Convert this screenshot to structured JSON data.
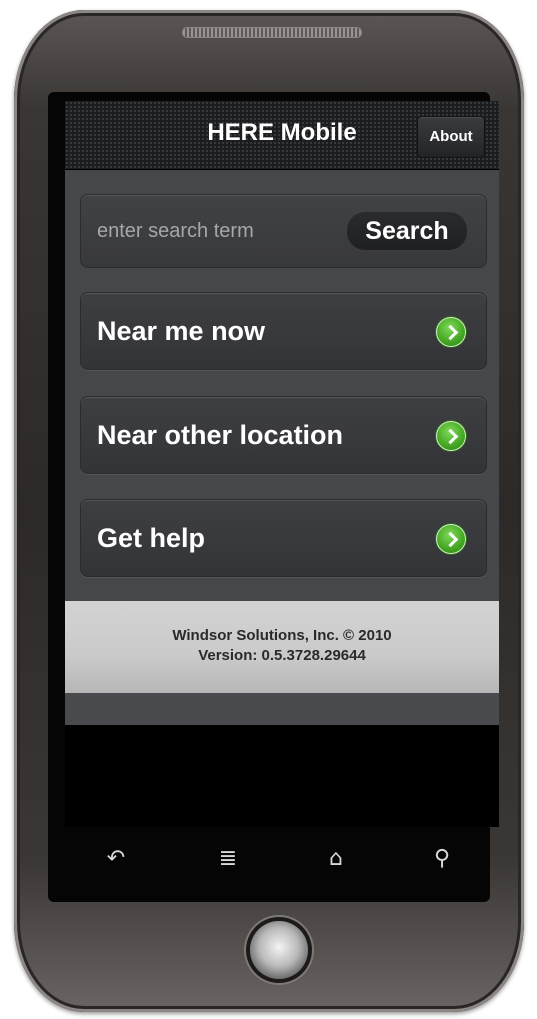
{
  "header": {
    "title": "HERE Mobile",
    "about_label": "About"
  },
  "search": {
    "placeholder": "enter search term",
    "button_label": "Search"
  },
  "menu": {
    "items": [
      {
        "label": "Near me now",
        "icon": "chevron-right-circle-icon"
      },
      {
        "label": "Near other location",
        "icon": "chevron-right-circle-icon"
      },
      {
        "label": "Get help",
        "icon": "chevron-right-circle-icon"
      }
    ]
  },
  "footer": {
    "copyright": "Windsor Solutions, Inc. © 2010",
    "version": "Version: 0.5.3728.29644"
  },
  "softkeys": {
    "back": "↶",
    "menu": "≣",
    "home": "⌂",
    "search": "⚲"
  },
  "colors": {
    "accent_green": "#3b9e1a",
    "titlebar_bg": "#1c1d1f",
    "content_bg": "#46474b",
    "footer_bg": "#d3d3d3"
  }
}
